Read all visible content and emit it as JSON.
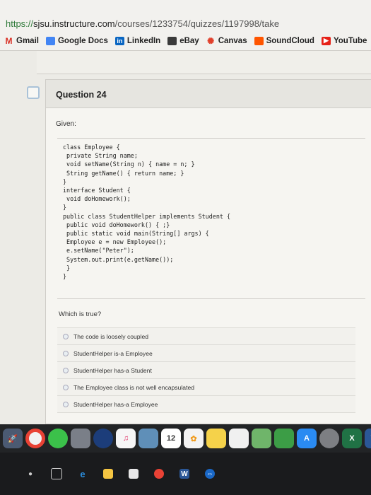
{
  "browser": {
    "url_proto": "https://",
    "url_host": "sjsu.instructure.com",
    "url_path": "/courses/1233754/quizzes/1197998/take"
  },
  "bookmarks": [
    {
      "label": "Gmail",
      "icon": "gmail-icon"
    },
    {
      "label": "Google Docs",
      "icon": "docs-icon"
    },
    {
      "label": "LinkedIn",
      "icon": "linkedin-icon"
    },
    {
      "label": "eBay",
      "icon": "ebay-icon"
    },
    {
      "label": "Canvas",
      "icon": "canvas-icon"
    },
    {
      "label": "SoundCloud",
      "icon": "soundcloud-icon"
    },
    {
      "label": "YouTube",
      "icon": "youtube-icon"
    }
  ],
  "question": {
    "title": "Question 24",
    "given_label": "Given:",
    "code": "class Employee {\n private String name;\n void setName(String n) { name = n; }\n String getName() { return name; }\n}\ninterface Student {\n void doHomework();\n}\npublic class StudentHelper implements Student {\n public void doHomework() { ;}\n public static void main(String[] args) {\n Employee e = new Employee();\n e.setName(\"Peter\");\n System.out.print(e.getName());\n }\n}",
    "prompt": "Which is true?",
    "options": [
      "The code is loosely coupled",
      "StudentHelper is-a Employee",
      "StudentHelper has-a Student",
      "The Employee class is not well encapsulated",
      "StudentHelper has-a Employee"
    ]
  }
}
